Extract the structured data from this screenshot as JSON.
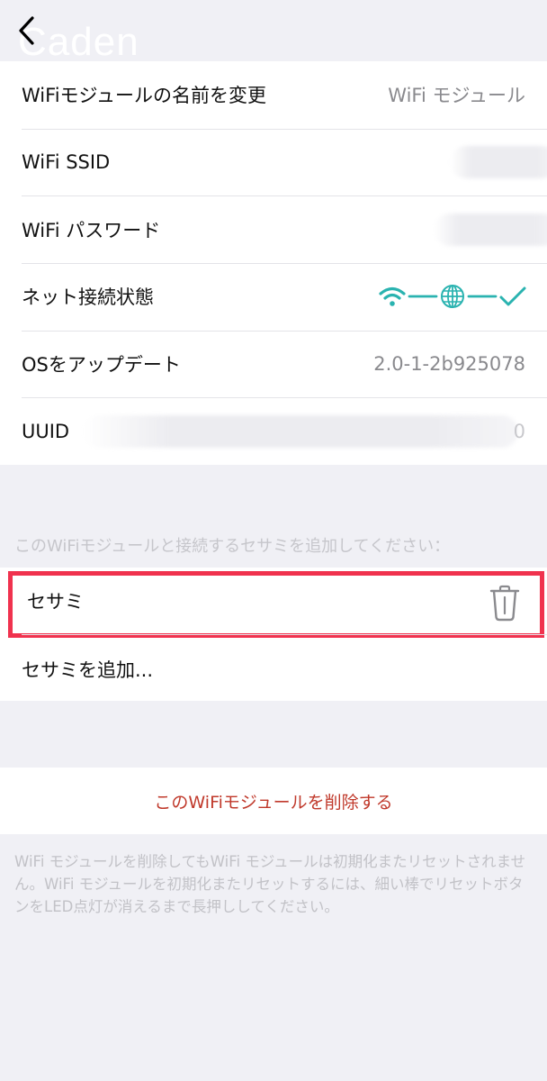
{
  "nav": {
    "title": "Caden"
  },
  "info": {
    "rename_label": "WiFiモジュールの名前を変更",
    "rename_value": "WiFi モジュール",
    "ssid_label": "WiFi SSID",
    "password_label": "WiFi パスワード",
    "status_label": "ネット接続状態",
    "os_label": "OSをアップデート",
    "os_value": "2.0-1-2b925078",
    "uuid_label": "UUID",
    "uuid_tail": "0"
  },
  "sesame_section": {
    "header": "このWiFiモジュールと接続するセサミを追加してください：",
    "items": [
      {
        "label": "セサミ"
      }
    ],
    "add_label": "セサミを追加..."
  },
  "delete": {
    "label": "このWiFiモジュールを削除する"
  },
  "footer": {
    "note": "WiFi モジュールを削除してもWiFi モジュールは初期化またリセットされません。WiFi モジュールを初期化またリセットするには、細い棒でリセットボタンをLED点灯が消えるまで長押ししてください。"
  },
  "colors": {
    "background": "#f0f0f5",
    "accent_teal": "#2ab3b0",
    "delete_red": "#c0392b",
    "highlight_red": "#f0324e",
    "secondary_text": "#8a8a8e"
  },
  "icons": {
    "back": "chevron-left-icon",
    "wifi": "wifi-icon",
    "globe": "globe-icon",
    "check": "checkmark-icon",
    "trash": "trash-icon"
  }
}
